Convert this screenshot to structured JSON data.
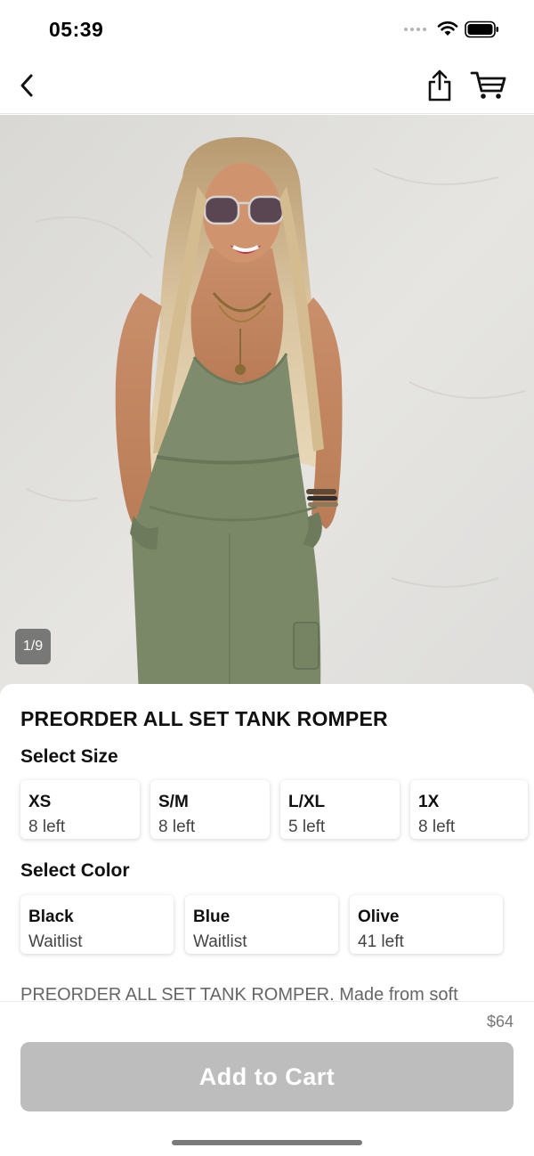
{
  "status_bar": {
    "time": "05:39"
  },
  "nav": {
    "back_icon": "chevron-left-icon",
    "share_icon": "share-icon",
    "cart_icon": "cart-icon"
  },
  "gallery": {
    "page_counter": "1/9",
    "image": "woman-in-olive-tank-romper-photo"
  },
  "product": {
    "title": "PREORDER ALL SET TANK ROMPER",
    "size_section_label": "Select Size",
    "sizes": [
      {
        "name": "XS",
        "stock": "8 left"
      },
      {
        "name": "S/M",
        "stock": "8 left"
      },
      {
        "name": "L/XL",
        "stock": "5 left"
      },
      {
        "name": "1X",
        "stock": "8 left"
      }
    ],
    "color_section_label": "Select Color",
    "colors": [
      {
        "name": "Black",
        "stock": "Waitlist"
      },
      {
        "name": "Blue",
        "stock": "Waitlist"
      },
      {
        "name": "Olive",
        "stock": "41 left"
      }
    ],
    "description": "PREORDER ALL SET TANK ROMPER. Made from soft"
  },
  "footer": {
    "price": "$64",
    "add_to_cart_label": "Add to Cart"
  },
  "colors": {
    "button_disabled": "#bdbdbd",
    "romper_olive": "#7e8b6c"
  }
}
